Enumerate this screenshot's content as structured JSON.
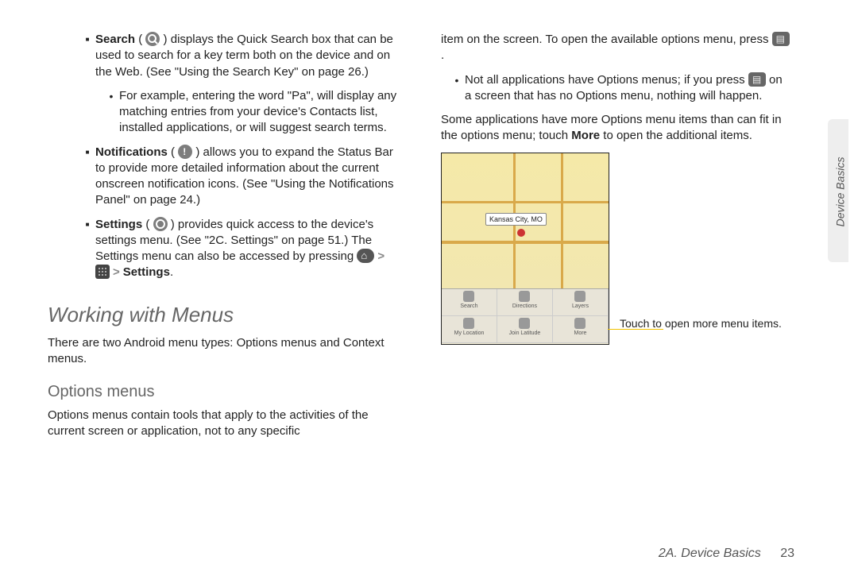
{
  "left": {
    "search": {
      "label": "Search",
      "body": " ) displays the Quick Search box that can be used to search for a key term both on the device and on the Web. (See \"Using the Search Key\" on page 26.)",
      "example": "For example, entering the word \"Pa\", will display any matching entries from your device's Contacts list, installed applications, or will suggest search terms."
    },
    "notifications": {
      "label": "Notifications",
      "body": " ) allows you to expand the Status Bar to provide more detailed information about the current onscreen notification icons. (See \"Using the Notifications Panel\" on page 24.)"
    },
    "settings": {
      "label": "Settings",
      "body1": " ) provides quick access to the device's settings menu. (See \"2C. Settings\" on page 51.) The Settings menu can also be accessed by pressing ",
      "settings_word": "Settings",
      "period": "."
    },
    "heading": "Working with Menus",
    "intro": "There are two Android menu types: Options menus and Context menus.",
    "subheading": "Options menus",
    "options_intro": "Options menus contain tools that apply to the activities of the current screen or application, not to any specific"
  },
  "right": {
    "cont1": "item on the screen. To open the available options menu, press ",
    "cont1_end": ".",
    "bullet": "Not all applications have Options menus; if you press ",
    "bullet_end": " on a screen that has no Options menu, nothing will happen.",
    "more": "Some applications have more Options menu items than can fit in the options menu; touch ",
    "more_word": "More",
    "more_end": " to open the additional items.",
    "callout": "Touch to open more menu items."
  },
  "figure": {
    "city": "Kansas City, MO",
    "cells": [
      "Search",
      "Directions",
      "Layers",
      "My Location",
      "Join Latitude",
      "More"
    ]
  },
  "sideTab": "Device Basics",
  "footer": {
    "section": "2A. Device Basics",
    "page": "23"
  }
}
